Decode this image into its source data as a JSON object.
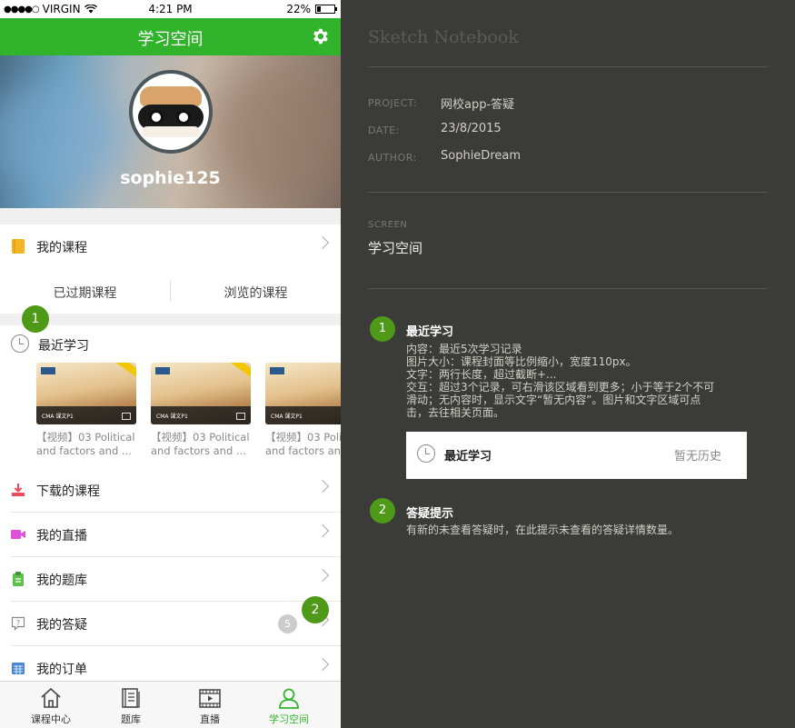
{
  "status_bar": {
    "signal": "●●●●○",
    "carrier": "VIRGIN",
    "time": "4:21 PM",
    "battery": "22%"
  },
  "nav": {
    "title": "学习空间",
    "settings_icon": "gear-icon"
  },
  "profile": {
    "username": "sophie125"
  },
  "menu": {
    "my_courses": "我的课程",
    "expired_courses": "已过期课程",
    "browsed_courses": "浏览的课程",
    "recent_title": "最近学习",
    "recent_items": [
      {
        "caption1": "【视频】03 Political",
        "caption2": "and factors and ...",
        "thumb_label": "CMA 课文P1"
      },
      {
        "caption1": "【视频】03 Political",
        "caption2": "and factors and ...",
        "thumb_label": "CMA 课文P1"
      },
      {
        "caption1": "【视频】03 Political",
        "caption2": "and factors and ...",
        "thumb_label": "CMA 课文P1"
      }
    ],
    "downloaded": "下载的课程",
    "live": "我的直播",
    "question_bank": "我的题库",
    "qa": "我的答疑",
    "qa_count": "5",
    "orders": "我的订单"
  },
  "markers": {
    "m1": "1",
    "m2": "2"
  },
  "tabbar": [
    {
      "label": "课程中心",
      "icon": "home-icon"
    },
    {
      "label": "题库",
      "icon": "book-icon"
    },
    {
      "label": "直播",
      "icon": "film-icon"
    },
    {
      "label": "学习空间",
      "icon": "user-icon"
    }
  ],
  "notebook": {
    "title": "Sketch Notebook",
    "project_label": "PROJECT:",
    "project": "网校app-答疑",
    "date_label": "DATE:",
    "date": "23/8/2015",
    "author_label": "AUTHOR:",
    "author": "SophieDream",
    "screen_label": "SCREEN",
    "screen": "学习空间",
    "notes": [
      {
        "num": "1",
        "title": "最近学习",
        "lines": [
          "内容：最近5次学习记录",
          "图片大小：课程封面等比例缩小，宽度110px。",
          "文字：两行长度，超过截断+...",
          "交互：超过3个记录，可右滑该区域看到更多；小于等于2个不可",
          "滑动；无内容时，显示文字“暂无内容”。图片和文字区域可点",
          "击，去往相关页面。"
        ]
      },
      {
        "num": "2",
        "title": "答疑提示",
        "lines": [
          "有新的未查看答疑时，在此提示未查看的答疑详情数量。"
        ]
      }
    ],
    "demo_title": "最近学习",
    "demo_empty": "暂无历史"
  },
  "colors": {
    "brand_green": "#32b32c",
    "marker_green": "#4e9a18",
    "notebook_bg": "#3b3c38"
  }
}
